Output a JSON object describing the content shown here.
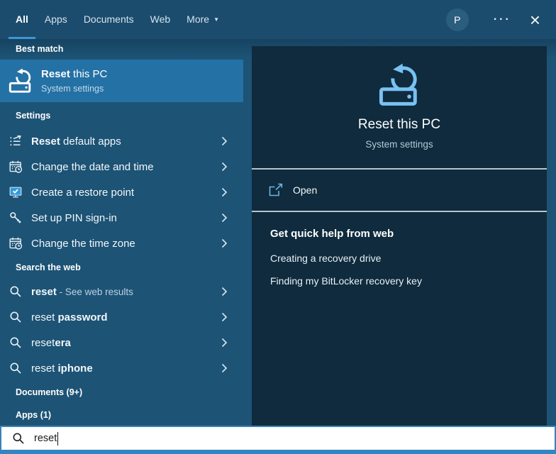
{
  "topbar": {
    "tabs": [
      {
        "label": "All",
        "active": true
      },
      {
        "label": "Apps",
        "active": false
      },
      {
        "label": "Documents",
        "active": false
      },
      {
        "label": "Web",
        "active": false
      },
      {
        "label": "More",
        "active": false,
        "dropdown": "▼"
      }
    ],
    "avatar_initial": "P",
    "overflow_label": "···",
    "close_label": "×"
  },
  "left_panel": {
    "best_match": {
      "header": "Best match",
      "item": {
        "icon": "reset-pc-icon",
        "title_bold": "Reset",
        "title_rest": " this PC",
        "subtitle": "System settings"
      }
    },
    "settings": {
      "header": "Settings",
      "items": [
        {
          "icon": "reset-apps-icon",
          "pre": "",
          "bold": "Reset",
          "rest": " default apps"
        },
        {
          "icon": "calendar-clock-icon",
          "pre": "",
          "bold": "",
          "rest": "Change the date and time"
        },
        {
          "icon": "restore-point-icon",
          "pre": "",
          "bold": "",
          "rest": "Create a restore point"
        },
        {
          "icon": "key-icon",
          "pre": "",
          "bold": "",
          "rest": "Set up PIN sign-in"
        },
        {
          "icon": "calendar-clock-icon",
          "pre": "",
          "bold": "",
          "rest": "Change the time zone"
        }
      ]
    },
    "search_web": {
      "header": "Search the web",
      "items": [
        {
          "icon": "search-icon",
          "pre": "",
          "bold": "reset",
          "suffix": " - See web results"
        },
        {
          "icon": "search-icon",
          "pre": "reset ",
          "bold": "password",
          "suffix": ""
        },
        {
          "icon": "search-icon",
          "pre": "reset",
          "bold": "era",
          "suffix": ""
        },
        {
          "icon": "search-icon",
          "pre": "reset ",
          "bold": "iphone",
          "suffix": ""
        }
      ]
    },
    "documents_header": "Documents (9+)",
    "apps_header": "Apps (1)"
  },
  "preview_panel": {
    "icon": "reset-pc-icon",
    "title": "Reset this PC",
    "subtitle": "System settings",
    "open_label": "Open",
    "help_header": "Get quick help from web",
    "help_links": [
      "Creating a recovery drive",
      "Finding my BitLocker recovery key"
    ]
  },
  "search_bar": {
    "value": "reset"
  },
  "colors": {
    "topbar_bg": "#1b4c6d",
    "panel_bg": "#1d5375",
    "highlight_bg": "#2471a5",
    "preview_bg": "#0f2b3d",
    "accent_icon_blue": "#79c1f2",
    "tab_underline": "#3f96d2",
    "divider": "#b9c3c9",
    "search_strip": "#2e86c6"
  }
}
